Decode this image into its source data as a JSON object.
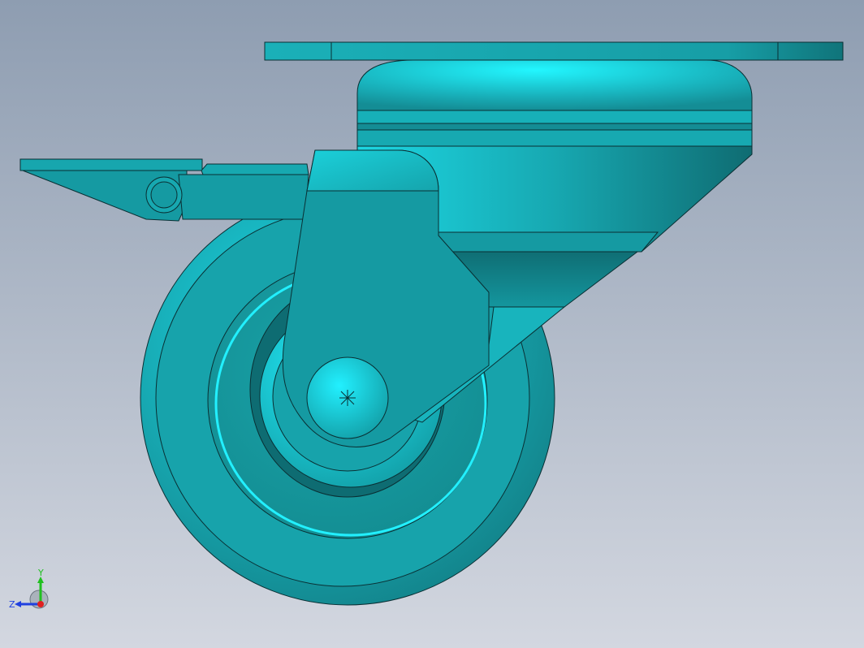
{
  "viewport": {
    "background_top": "#8e9db1",
    "background_bottom": "#d3d7e0"
  },
  "model": {
    "name": "swivel-caster-with-brake",
    "body_color": "#159a9c",
    "highlight_color": "#1ff2ff",
    "edge_color": "#0a2f33"
  },
  "triad": {
    "x_label": "",
    "y_label": "Y",
    "z_label": "Z",
    "x_color": "#e02020",
    "y_color": "#20c020",
    "z_color": "#2040e0"
  }
}
